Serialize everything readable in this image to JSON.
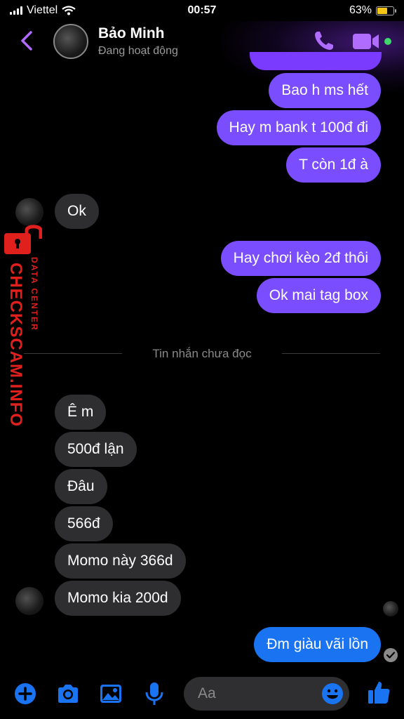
{
  "status_bar": {
    "carrier": "Viettel",
    "time": "00:57",
    "battery": "63%",
    "battery_level": 0.63
  },
  "header": {
    "name": "Bảo Minh",
    "status": "Đang hoạt động",
    "accent": "#b06bff",
    "online_color": "#3fd86a"
  },
  "messages_top": {
    "m1": "Bao h ms hết",
    "m2": "Hay m bank t 100đ đi",
    "m3": "T còn 1đ à",
    "m4": "Ok",
    "m5": "Hay chơi kèo 2đ thôi",
    "m6": "Ok mai tag box"
  },
  "divider": {
    "label": "Tin nhắn chưa đọc"
  },
  "messages_unread": {
    "m1": "Ê m",
    "m2": "500đ lận",
    "m3": "Đâu",
    "m4": "566đ",
    "m5": "Momo này 366d",
    "m6": "Momo kia 200d",
    "m7": "Đm giàu vãi lồn"
  },
  "watermark": {
    "title": "CHECKSCAM.INFO",
    "subtitle": "DATA CENTER",
    "color": "#e0201d"
  },
  "composer": {
    "placeholder": "Aa"
  },
  "colors": {
    "outgoing": "#7a4dff",
    "outgoing_last": "#1a74f2",
    "incoming": "#2e2e30",
    "icon_blue": "#1a74f2"
  }
}
